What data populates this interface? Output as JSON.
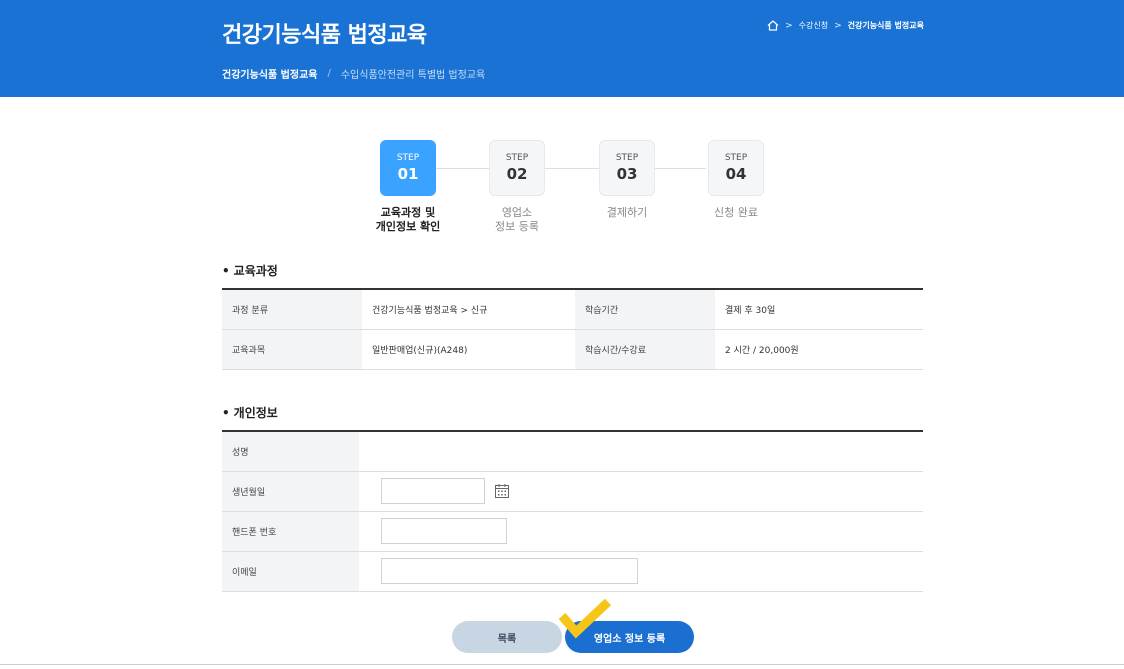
{
  "header": {
    "title": "건강기능식품 법정교육",
    "breadcrumb": {
      "home_icon": "home-icon",
      "item1": "수강신청",
      "item2": "건강기능식품 법정교육",
      "separator": ">"
    },
    "subnav": {
      "active": "건강기능식품 법정교육",
      "divider": "/",
      "inactive": "수입식품안전관리 특별법 법정교육"
    }
  },
  "steps": [
    {
      "step": "STEP",
      "num": "01",
      "label_line1": "교육과정 및",
      "label_line2": "개인정보 확인",
      "active": true
    },
    {
      "step": "STEP",
      "num": "02",
      "label_line1": "영업소",
      "label_line2": "정보 등록",
      "active": false
    },
    {
      "step": "STEP",
      "num": "03",
      "label_line1": "결제하기",
      "label_line2": "",
      "active": false
    },
    {
      "step": "STEP",
      "num": "04",
      "label_line1": "신청 완료",
      "label_line2": "",
      "active": false
    }
  ],
  "course": {
    "title": "교육과정",
    "rows": [
      {
        "h1": "과정 분류",
        "v1": "건강기능식품 법정교육 > 신규",
        "h2": "학습기간",
        "v2": "결제 후 30일"
      },
      {
        "h1": "교육과목",
        "v1": "일반판매업(신규)(A248)",
        "h2": "학습시간/수강료",
        "v2": "2 시간 / 20,000원"
      }
    ]
  },
  "personal": {
    "title": "개인정보",
    "name_label": "성명",
    "birth_label": "생년월일",
    "phone_label": "핸드폰 번호",
    "email_label": "이메일",
    "calendar_icon": "calendar-icon"
  },
  "buttons": {
    "list": "목록",
    "next": "영업소 정보 등록"
  },
  "colors": {
    "brand": "#1a73d4",
    "step_active": "#3aa3ff",
    "button_primary": "#1a6fd0",
    "button_secondary": "#c8d5e3",
    "check": "#f5c518"
  }
}
